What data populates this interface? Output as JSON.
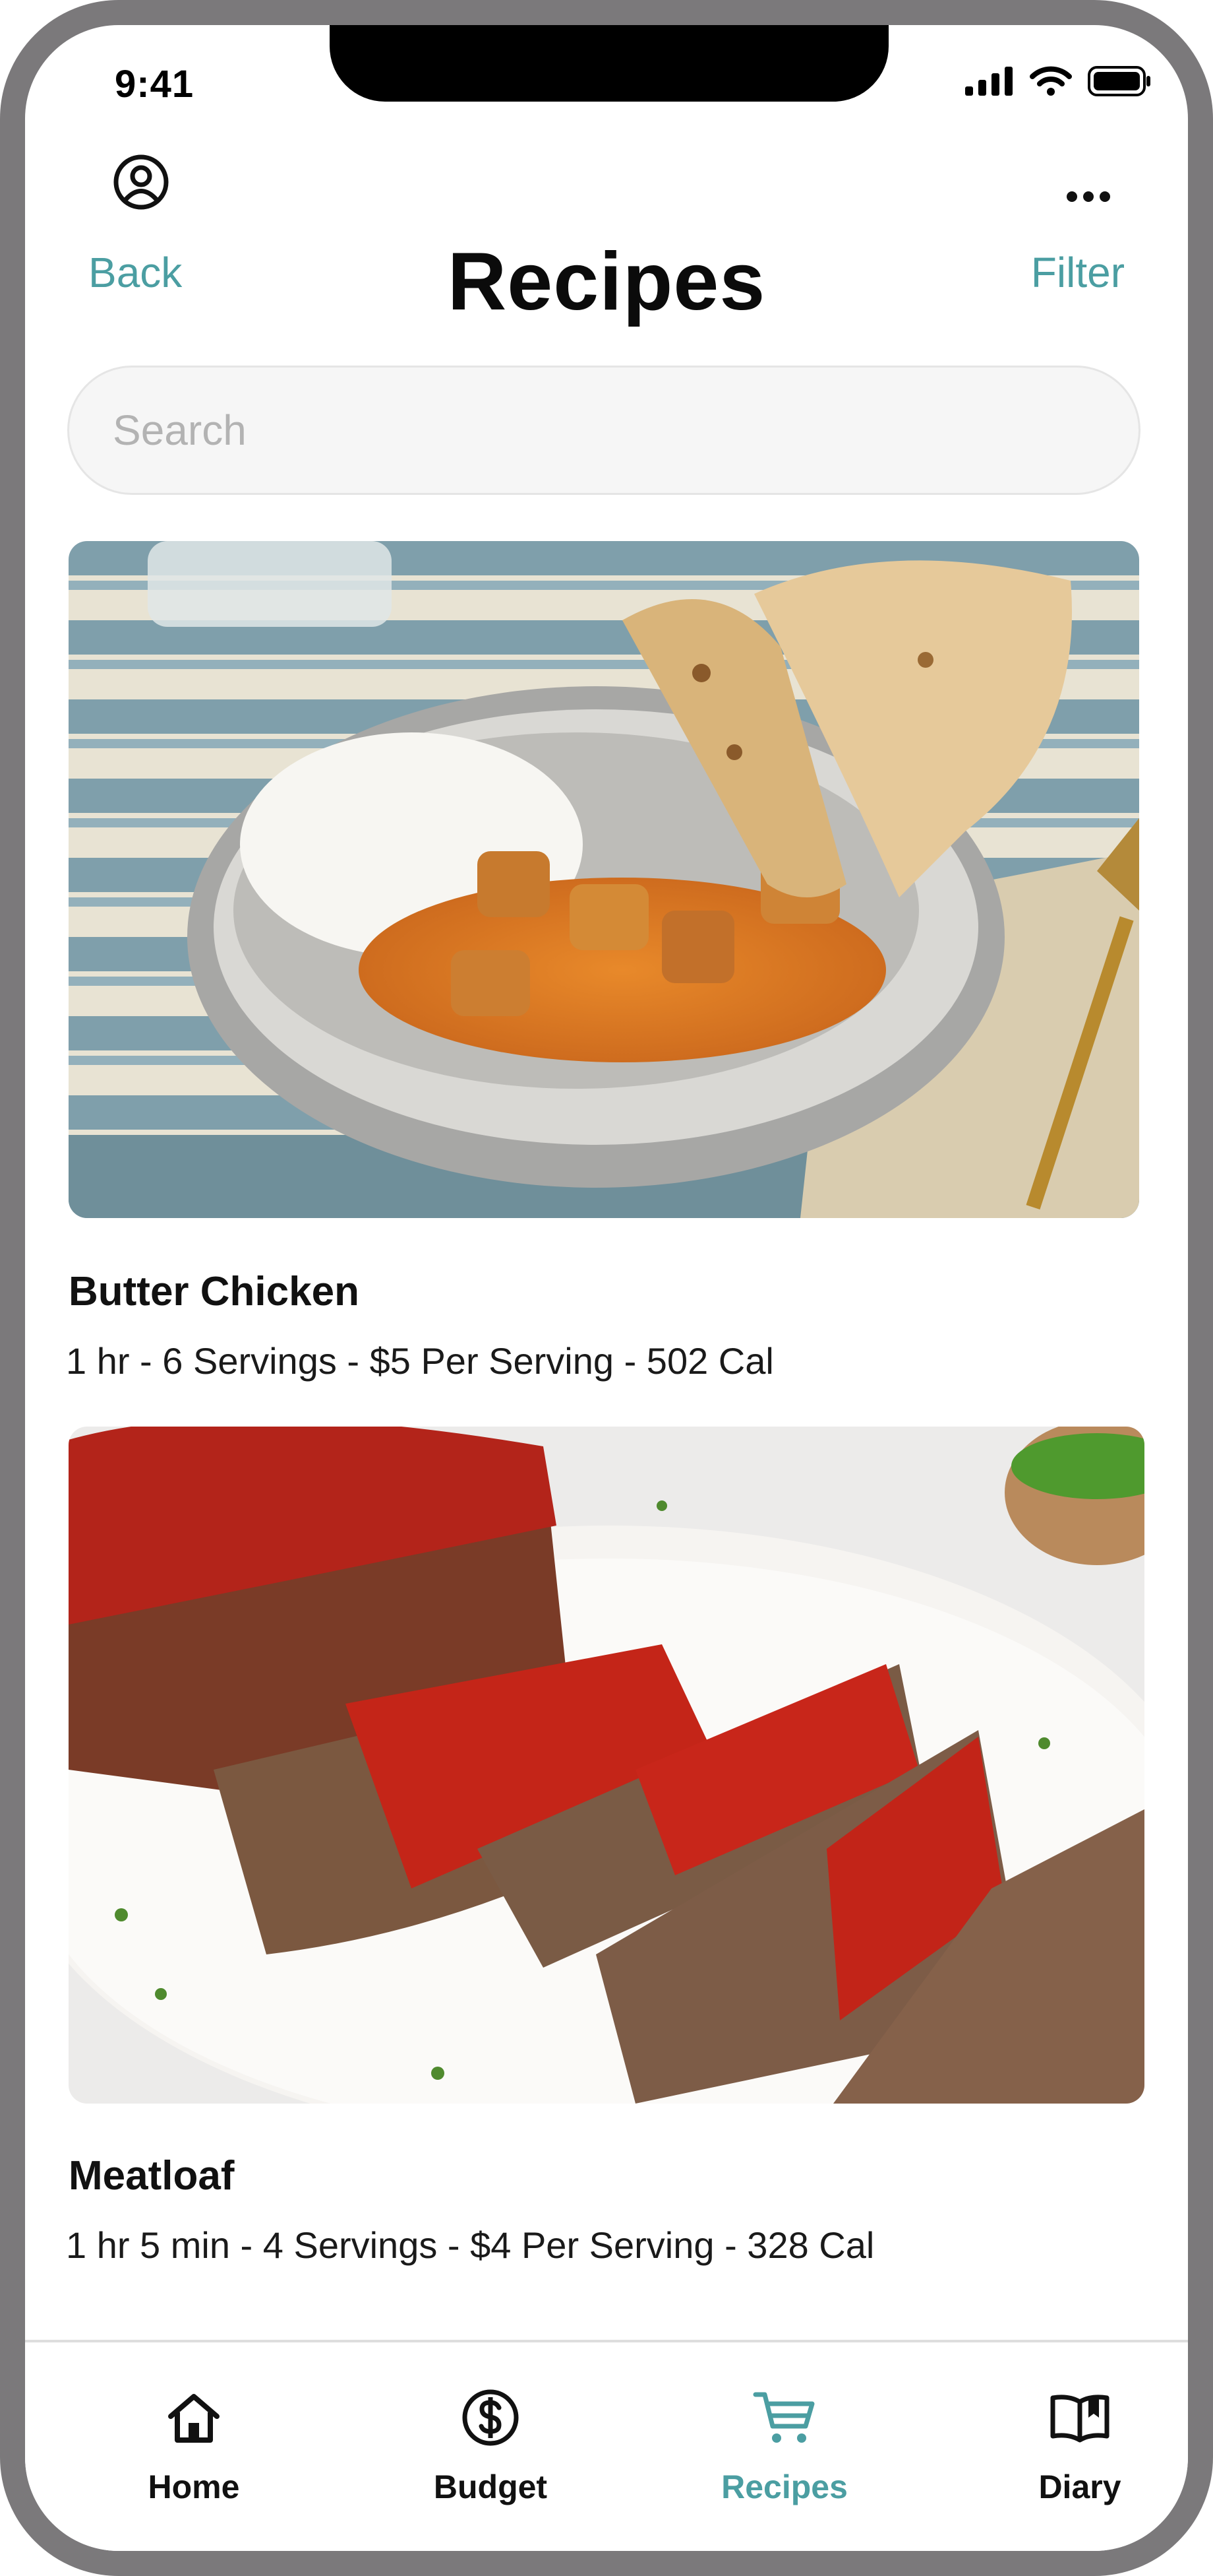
{
  "status_bar": {
    "time": "9:41"
  },
  "header": {
    "back_label": "Back",
    "title": "Recipes",
    "filter_label": "Filter"
  },
  "search": {
    "placeholder": "Search",
    "value": ""
  },
  "recipes": [
    {
      "name": "Butter Chicken",
      "meta": "1 hr - 6 Servings - $5 Per Serving - 502 Cal"
    },
    {
      "name": "Meatloaf",
      "meta": "1 hr 5 min - 4 Servings - $4 Per Serving - 328 Cal"
    }
  ],
  "tabbar": {
    "items": [
      {
        "label": "Home",
        "icon": "home-icon"
      },
      {
        "label": "Budget",
        "icon": "dollar-circle-icon"
      },
      {
        "label": "Recipes",
        "icon": "cart-icon",
        "active": true
      },
      {
        "label": "Diary",
        "icon": "book-icon"
      }
    ]
  },
  "colors": {
    "accent": "#4b9ea2",
    "frame": "#7b797b",
    "text": "#111111"
  }
}
